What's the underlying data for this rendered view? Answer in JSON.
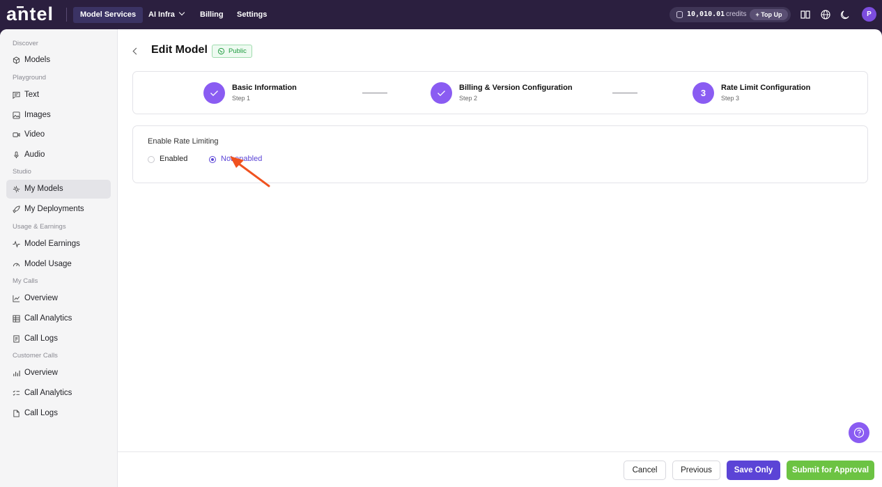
{
  "brand": {
    "logo_text": "antel"
  },
  "topbar": {
    "nav": [
      {
        "label": "Model Services",
        "active": true
      },
      {
        "label": "AI Infra",
        "has_dropdown": true
      },
      {
        "label": "Billing"
      },
      {
        "label": "Settings"
      }
    ],
    "credits": {
      "amount": "10,010.01",
      "unit": "credits",
      "topup_label": "+ Top Up"
    },
    "icons": [
      "docs-icon",
      "globe-icon",
      "moon-icon"
    ],
    "avatar_initial": "P"
  },
  "sidebar": {
    "sections": [
      {
        "label": "Discover",
        "items": [
          {
            "label": "Models",
            "icon": "cube-icon"
          }
        ]
      },
      {
        "label": "Playground",
        "items": [
          {
            "label": "Text",
            "icon": "chat-icon"
          },
          {
            "label": "Images",
            "icon": "image-icon"
          },
          {
            "label": "Video",
            "icon": "video-icon"
          },
          {
            "label": "Audio",
            "icon": "mic-icon"
          }
        ]
      },
      {
        "label": "Studio",
        "items": [
          {
            "label": "My Models",
            "icon": "models-icon",
            "active": true
          },
          {
            "label": "My Deployments",
            "icon": "rocket-icon"
          }
        ]
      },
      {
        "label": "Usage & Earnings",
        "items": [
          {
            "label": "Model Earnings",
            "icon": "pulse-icon"
          },
          {
            "label": "Model Usage",
            "icon": "gauge-icon"
          }
        ]
      },
      {
        "label": "My Calls",
        "items": [
          {
            "label": "Overview",
            "icon": "line-chart-icon"
          },
          {
            "label": "Call Analytics",
            "icon": "table-icon"
          },
          {
            "label": "Call Logs",
            "icon": "logs-icon"
          }
        ]
      },
      {
        "label": "Customer Calls",
        "items": [
          {
            "label": "Overview",
            "icon": "bar-chart-icon"
          },
          {
            "label": "Call Analytics",
            "icon": "list-check-icon"
          },
          {
            "label": "Call Logs",
            "icon": "file-icon"
          }
        ]
      }
    ]
  },
  "page": {
    "title": "Edit Model",
    "badge": "Public",
    "steps": [
      {
        "title": "Basic Information",
        "subtitle": "Step 1",
        "state": "done"
      },
      {
        "title": "Billing & Version Configuration",
        "subtitle": "Step 2",
        "state": "done"
      },
      {
        "title": "Rate Limit Configuration",
        "subtitle": "Step 3",
        "state": "current",
        "number": "3"
      }
    ],
    "rate_limit": {
      "label": "Enable Rate Limiting",
      "options": [
        {
          "label": "Enabled",
          "selected": false
        },
        {
          "label": "Not enabled",
          "selected": true
        }
      ]
    }
  },
  "footer": {
    "cancel_label": "Cancel",
    "previous_label": "Previous",
    "save_label": "Save Only",
    "submit_label": "Submit for Approval"
  },
  "colors": {
    "accent": "#5b44d6",
    "step": "#8a5cf2",
    "success": "#6cc343",
    "topbar": "#2b1f3f",
    "annotation_arrow": "#f0521f"
  }
}
